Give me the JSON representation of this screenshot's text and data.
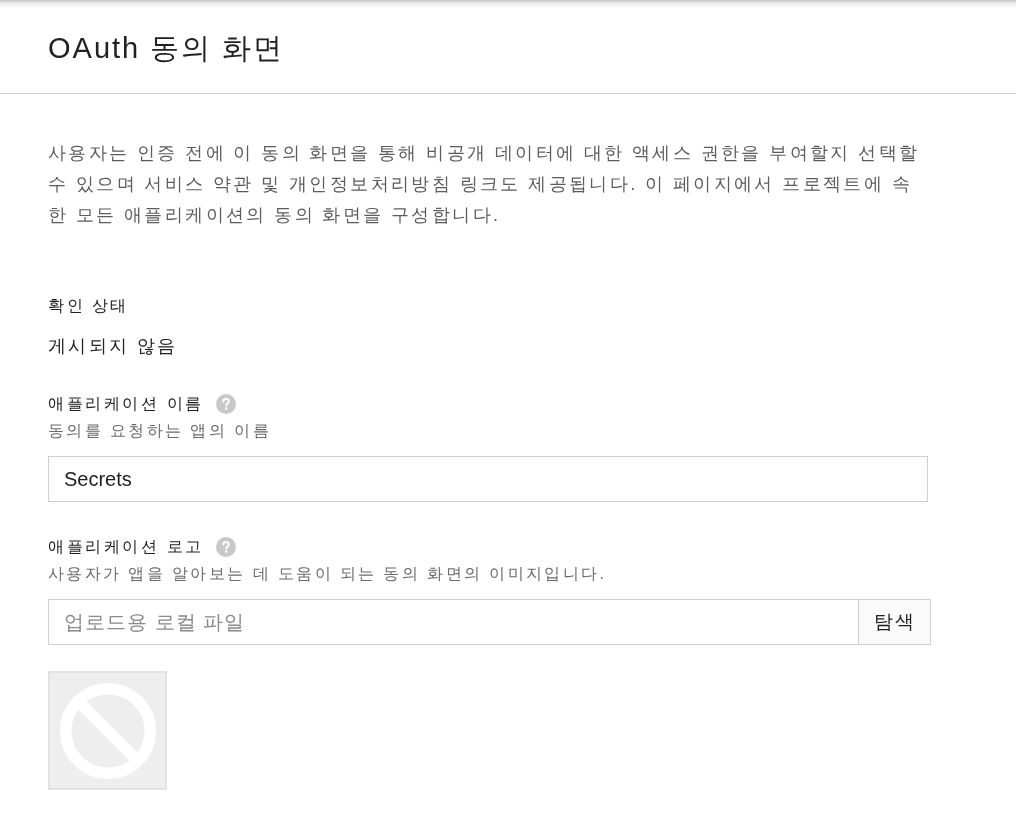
{
  "header": {
    "title": "OAuth 동의 화면"
  },
  "description": "사용자는 인증 전에 이 동의 화면을 통해 비공개 데이터에 대한 액세스 권한을 부여할지 선택할 수 있으며 서비스 약관 및 개인정보처리방침 링크도 제공됩니다. 이 페이지에서 프로젝트에 속한 모든 애플리케이션의 동의 화면을 구성합니다.",
  "status": {
    "label": "확인 상태",
    "value": "게시되지 않음"
  },
  "fields": [
    {
      "kind": "text",
      "label": "애플리케이션 이름",
      "hint": "동의를 요청하는 앱의 이름",
      "value": "Secrets"
    },
    {
      "kind": "file",
      "label": "애플리케이션 로고",
      "hint": "사용자가 앱을 알아보는 데 도움이 되는 동의 화면의 이미지입니다.",
      "placeholder": "업로드용 로컬 파일",
      "button": "탐색"
    }
  ]
}
